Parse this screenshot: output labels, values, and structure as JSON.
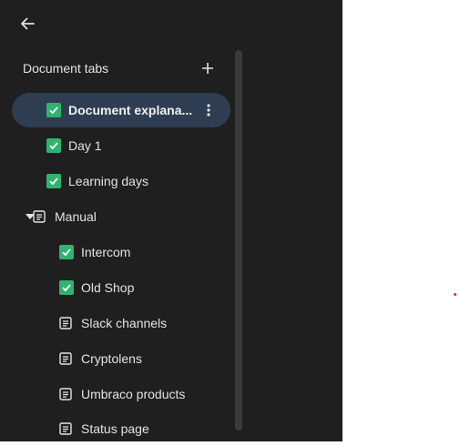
{
  "sidebar": {
    "title": "Document tabs",
    "tabs": [
      {
        "label": "Document explana...",
        "icon": "checkbox-checked-icon",
        "active": true
      },
      {
        "label": "Day 1",
        "icon": "checkbox-checked-icon"
      },
      {
        "label": "Learning days",
        "icon": "checkbox-checked-icon"
      },
      {
        "label": "Manual",
        "icon": "document-icon",
        "expanded": true
      },
      {
        "label": "Intercom",
        "icon": "checkbox-checked-icon"
      },
      {
        "label": "Old Shop",
        "icon": "checkbox-checked-icon"
      },
      {
        "label": "Slack channels",
        "icon": "document-icon"
      },
      {
        "label": "Cryptolens",
        "icon": "document-icon"
      },
      {
        "label": "Umbraco products",
        "icon": "document-icon"
      },
      {
        "label": "Status page",
        "icon": "document-icon"
      }
    ]
  },
  "colors": {
    "panel_bg": "#1f1f1f",
    "active_bg": "#2e3d52",
    "checkbox": "#2fb36f",
    "text": "#e3e3e3",
    "marker": "#d9302c"
  }
}
